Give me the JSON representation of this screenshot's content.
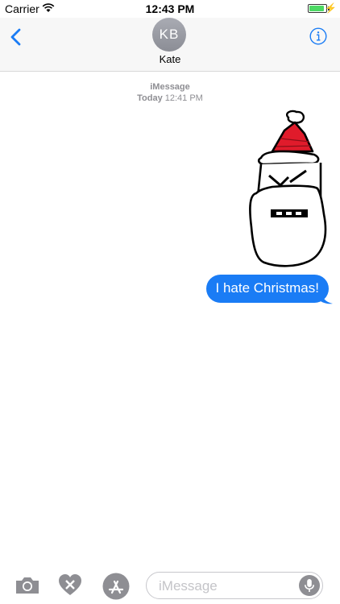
{
  "status_bar": {
    "carrier": "Carrier",
    "time": "12:43 PM",
    "battery_level": 0.9
  },
  "header": {
    "avatar_initials": "KB",
    "contact_name": "Kate"
  },
  "transcript": {
    "service_label": "iMessage",
    "day_label": "Today",
    "time_label": "12:41 PM",
    "messages": [
      {
        "type": "sticker",
        "icon": "santa-drawing",
        "direction": "outgoing"
      },
      {
        "type": "text",
        "text": "I hate Christmas!",
        "direction": "outgoing"
      }
    ]
  },
  "input_bar": {
    "placeholder": "iMessage",
    "value": ""
  },
  "colors": {
    "accent": "#1a7cf5",
    "hat_red": "#e01b2b",
    "battery_green": "#4cd964"
  }
}
